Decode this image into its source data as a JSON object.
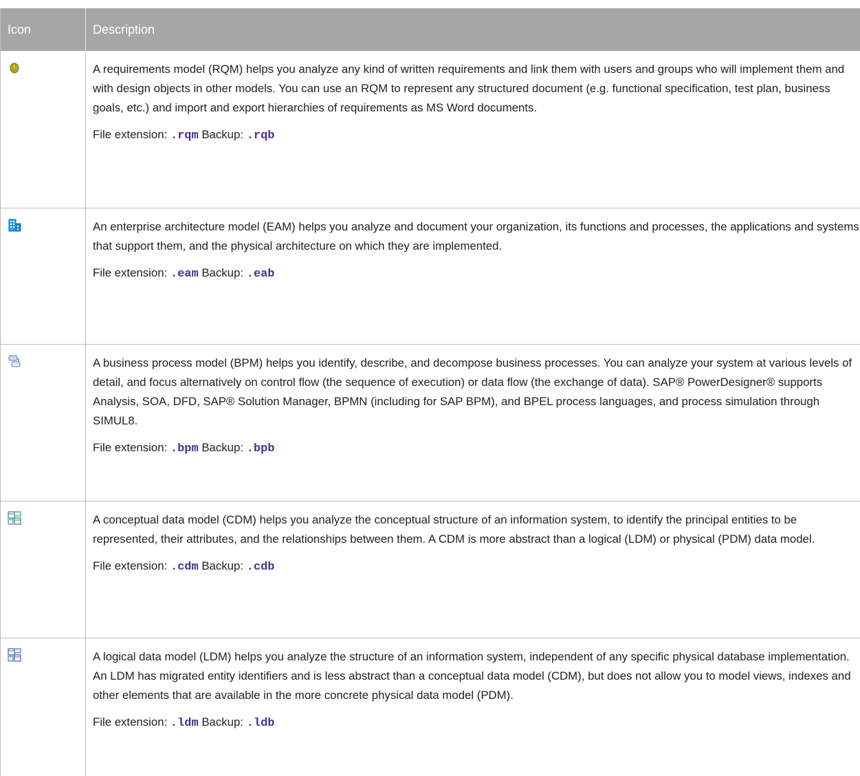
{
  "header": {
    "col_icon": "Icon",
    "col_description": "Description"
  },
  "rows": [
    {
      "icon": "requirements-model-icon",
      "description": "A requirements model (RQM) helps you analyze any kind of written requirements and link them with users and groups who will implement them and with design objects in other models. You can use an RQM to represent any structured document (e.g. functional specification, test plan, business goals, etc.) and import and export hierar­chies of requirements as MS Word documents.",
      "ext_label": "File extension:",
      "ext": ".rqm",
      "backup_label": "Backup:",
      "backup": ".rqb"
    },
    {
      "icon": "enterprise-architecture-model-icon",
      "description": "An enterprise architecture model (EAM) helps you analyze and document your organization, its functions and processes, the applications and systems that support them, and the physical architecture on which they are imple­mented.",
      "ext_label": "File extension:",
      "ext": ".eam",
      "backup_label": "Backup:",
      "backup": ".eab"
    },
    {
      "icon": "business-process-model-icon",
      "description": "A business process model (BPM) helps you identify, describe, and decompose business processes. You can ana­lyze your system at various levels of detail, and focus alternatively on control flow (the sequence of execution) or data flow (the exchange of data). SAP® PowerDesigner® supports Analysis, SOA, DFD, SAP® Solution Manager, BPMN (including for SAP BPM), and BPEL process languages, and process simulation through SIMUL8.",
      "ext_label": "File extension:",
      "ext": ".bpm",
      "backup_label": "Backup:",
      "backup": ".bpb"
    },
    {
      "icon": "conceptual-data-model-icon",
      "description": "A conceptual data model (CDM) helps you analyze the conceptual structure of an information system, to identify the principal entities to be represented, their attributes, and the relationships between them. A CDM is more ab­stract than a logical (LDM) or physical (PDM) data model.",
      "ext_label": "File extension:",
      "ext": ".cdm",
      "backup_label": "Backup:",
      "backup": ".cdb"
    },
    {
      "icon": "logical-data-model-icon",
      "description": "A logical data model (LDM) helps you analyze the structure of an information system, independent of any specific physical database implementation. An LDM has migrated entity identifiers and is less abstract than a conceptual data model (CDM), but does not allow you to model views, indexes and other elements that are available in the more concrete physical data model (PDM).",
      "ext_label": "File extension:",
      "ext": ".ldm",
      "backup_label": "Backup:",
      "backup": ".ldb"
    }
  ]
}
